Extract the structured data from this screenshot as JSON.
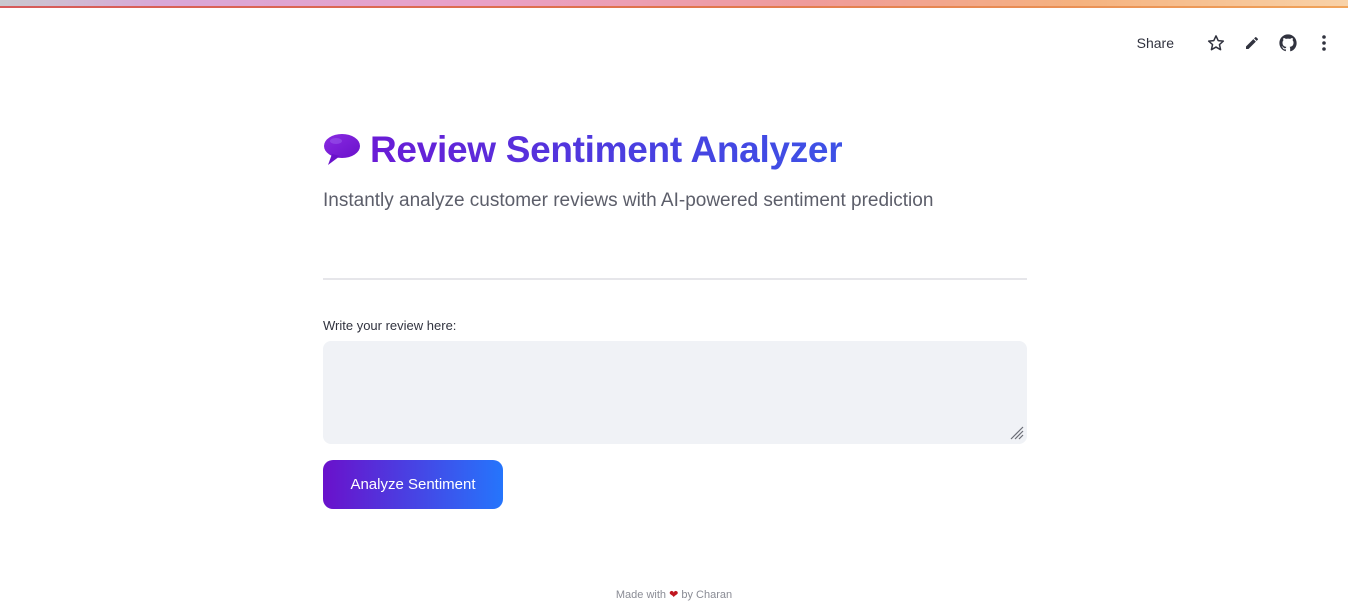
{
  "header": {
    "share_label": "Share",
    "icons": [
      "star-icon",
      "pencil-icon",
      "github-icon",
      "more-vertical-icon"
    ]
  },
  "main": {
    "title_icon": "speech-balloon-icon",
    "title": "Review Sentiment Analyzer",
    "subtitle": "Instantly analyze customer reviews with AI-powered sentiment prediction",
    "review_label": "Write your review here:",
    "review_value": "",
    "review_placeholder": "",
    "analyze_button_label": "Analyze Sentiment"
  },
  "footer": {
    "prefix": "Made with",
    "heart_icon": "heart-icon",
    "suffix": "by Charan"
  },
  "colors": {
    "title_gradient_start": "#6a1bd6",
    "title_gradient_end": "#3d52e6",
    "button_gradient_start": "#6a11cb",
    "button_gradient_end": "#2575fc",
    "textarea_bg": "#f0f2f6",
    "heart": "#c0161f"
  }
}
